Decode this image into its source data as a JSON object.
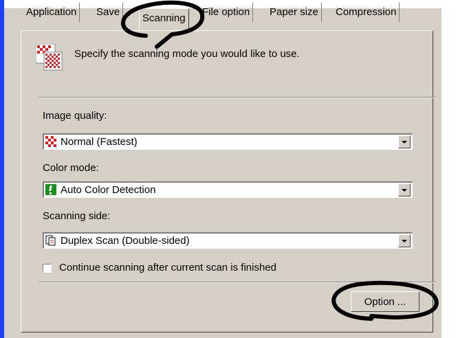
{
  "tabs": [
    {
      "label": "Application"
    },
    {
      "label": "Save"
    },
    {
      "label": "Scanning"
    },
    {
      "label": "File option"
    },
    {
      "label": "Paper size"
    },
    {
      "label": "Compression"
    }
  ],
  "intro_text": "Specify the scanning mode you would like to use.",
  "image_quality": {
    "label": "Image quality:",
    "value": "Normal (Fastest)"
  },
  "color_mode": {
    "label": "Color mode:",
    "value": "Auto Color Detection"
  },
  "scanning_side": {
    "label": "Scanning side:",
    "value": "Duplex Scan (Double-sided)"
  },
  "continue_checkbox": {
    "label": "Continue scanning after current scan is finished",
    "checked": false
  },
  "option_button": {
    "label": "Option ..."
  },
  "colors": {
    "accent_blue": "#1f3fff",
    "dialog_bg": "#d4d0c8",
    "icon_red": "#e02020",
    "icon_green": "#1a8f1a"
  }
}
